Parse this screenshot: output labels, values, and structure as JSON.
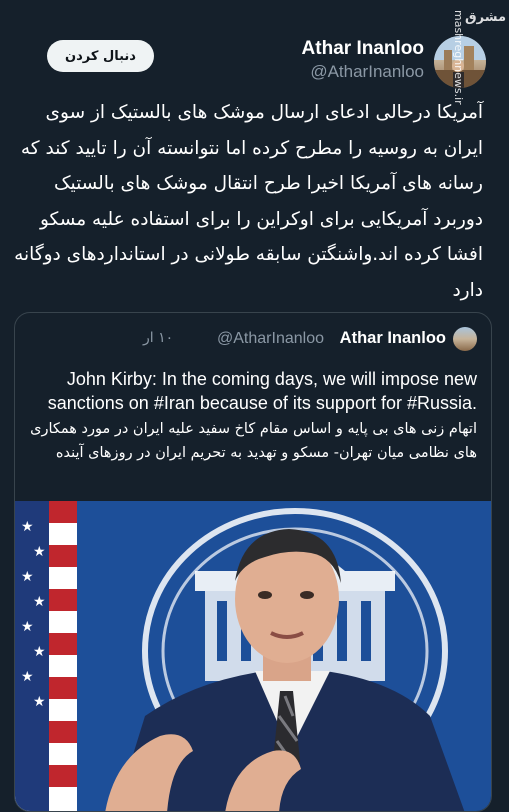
{
  "author": {
    "name": "Athar Inanloo",
    "handle": "@AtharInanloo",
    "follow_label": "دنبال کردن"
  },
  "tweet": {
    "text": "آمریکا درحالی ادعای ارسال موشک های بالستیک از سوی ایران به روسیه را مطرح کرده اما نتوانسته آن را تایید کند که رسانه های آمریکا اخیرا طرح انتقال موشک های بالستیک دوربرد آمریکایی برای اوکراین را برای استفاده علیه مسکو افشا کرده اند.واشنگتن سابقه طولانی در استانداردهای دوگانه دارد"
  },
  "quote": {
    "name": "Athar Inanloo",
    "handle": "@AtharInanloo",
    "time": "۱۰ ار",
    "text_en": "John Kirby: In the coming days, we will impose new sanctions on #Iran because of its support for #Russia.",
    "text_fa": "اتهام زنی های بی پایه و اساس مقام کاخ سفید علیه ایران در مورد همکاری های نظامی میان تهران- مسکو و تهدید به تحریم ایران در روزهای آینده"
  },
  "watermark": {
    "text": "mashreghnews.ir",
    "logo_text": "مشرق"
  },
  "colors": {
    "background": "#15202b",
    "secondary_text": "#8b98a5",
    "border": "#38444d",
    "button_bg": "#eff3f4"
  }
}
